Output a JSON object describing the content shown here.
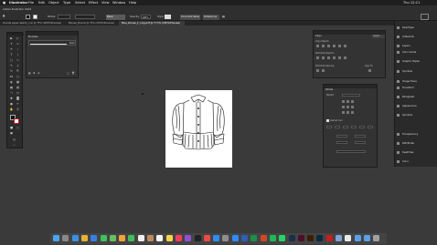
{
  "menubar": {
    "apple": "",
    "items": [
      "Illustrator",
      "File",
      "Edit",
      "Object",
      "Type",
      "Select",
      "Effect",
      "View",
      "Window",
      "Help"
    ],
    "window_title": "Adobe Illustrator 2021",
    "clock": "Thu 12:21"
  },
  "control_bar": {
    "stroke_label": "Stroke:",
    "style_value": "Basic",
    "opacity_label": "Opacity:",
    "opacity_value": "100%",
    "style_label": "Style:",
    "doc_setup": "Document Setup",
    "preferences": "Preferences"
  },
  "tabs": [
    {
      "label": "Doodle paper sketch_1.ai @ 75% (CMYK/Preview)",
      "active": false
    },
    {
      "label": "Blouse_final.ai @ 75% (CMYK/Preview)",
      "active": false
    },
    {
      "label": "Blue_blouse_2_copy.pdf @ 77.5% (CMYK/Preview)",
      "active": true
    }
  ],
  "brushes_panel": {
    "title": "Brushes",
    "brush_name": "Basic"
  },
  "align_panel": {
    "tab": "Align",
    "align_objects": "Align Objects:",
    "distribute_objects": "Distribute Objects:",
    "distribute_spacing": "Distribute Spacing:",
    "align_to": "Align To:",
    "layers_tab": "Layers"
  },
  "stroke_panel": {
    "title": "Stroke",
    "weight_label": "Weight:",
    "dashed_line": "Dashed Line"
  },
  "right_dock": [
    {
      "label": "OpenType",
      "icon": "opentype-icon"
    },
    {
      "label": "Artboards",
      "icon": "artboards-icon"
    },
    {
      "label": "Layers",
      "icon": "layers-icon"
    },
    {
      "label": "Color Guide",
      "icon": "color-guide-icon"
    },
    {
      "label": "Graphic Styles",
      "icon": "graphic-styles-icon"
    },
    {
      "label": "Symbols",
      "icon": "symbols-icon"
    },
    {
      "label": "Image Trace",
      "icon": "image-trace-icon"
    },
    {
      "label": "Transform",
      "icon": "transform-icon"
    },
    {
      "label": "Paragraph",
      "icon": "paragraph-icon"
    },
    {
      "label": "Appearance",
      "icon": "appearance-icon"
    },
    {
      "label": "Symbols",
      "icon": "symbols-icon"
    },
    {
      "label": "Transparency",
      "icon": "transparency-icon"
    },
    {
      "label": "Pathfinder",
      "icon": "pathfinder-icon"
    },
    {
      "label": "Swatches",
      "icon": "swatches-icon"
    },
    {
      "label": "Color",
      "icon": "color-icon"
    }
  ],
  "dock_apps": [
    "finder",
    "launchpad",
    "safari",
    "chrome",
    "mail",
    "messages",
    "maps",
    "photos",
    "facetime",
    "calendar",
    "contacts",
    "reminders",
    "notes",
    "music",
    "podcasts",
    "tv",
    "news",
    "app-store",
    "settings",
    "zoom",
    "word",
    "excel",
    "powerpoint",
    "spotify",
    "whatsapp",
    "photoshop",
    "indesign",
    "illustrator",
    "lightroom",
    "acrobat",
    "preview",
    "textedit",
    "folder",
    "downloads",
    "trash"
  ]
}
